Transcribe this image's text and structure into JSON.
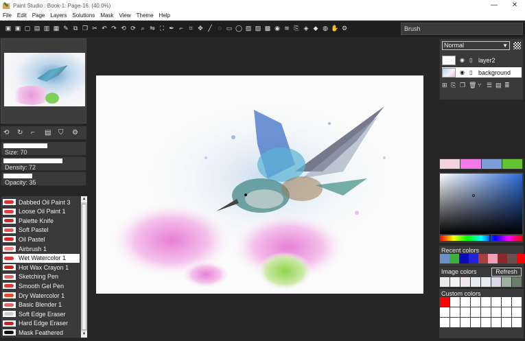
{
  "window": {
    "title": "Paint Studio : Book-1: Page-16: (40.0%)",
    "controls": [
      "—",
      "☐",
      "✕"
    ]
  },
  "menu": [
    "File",
    "Edit",
    "Page",
    "Layers",
    "Solutions",
    "Mask",
    "View",
    "Theme",
    "Help"
  ],
  "toolbar": {
    "icons": [
      "save-icon",
      "save-as-icon",
      "new-icon",
      "import-icon",
      "export-icon",
      "print-icon",
      "brush-tool-icon",
      "paste-icon",
      "copy-icon",
      "cut-icon",
      "undo-icon",
      "redo-icon",
      "rotate-left-icon",
      "rotate-right-icon",
      "zoom-icon",
      "flip-icon",
      "zoom-fit-icon",
      "pen-icon",
      "eyedropper-icon",
      "crop-icon",
      "move-icon",
      "line-icon",
      "lasso-icon",
      "rect-icon",
      "ellipse-icon",
      "fill-icon",
      "gradient-icon",
      "texture-icon",
      "eye-tool-icon",
      "smudge-icon",
      "clone-icon",
      "sharpen-icon",
      "stamp-icon",
      "blur-icon",
      "hand-icon",
      "settings-icon"
    ],
    "brush_name": "Brush"
  },
  "left": {
    "sliders": [
      {
        "label": "Size: 70",
        "value": 70,
        "max": 100
      },
      {
        "label": "Density: 72",
        "value": 72,
        "max": 100
      },
      {
        "label": "Opacity: 35",
        "value": 35,
        "max": 100
      }
    ],
    "tool_icons": [
      "rotate-icon",
      "refresh-icon",
      "pipette-icon",
      "layers-icon",
      "bucket-icon",
      "settings-icon"
    ],
    "brushes": [
      {
        "name": "Dabbed Oil Paint 3",
        "color": "#d93030"
      },
      {
        "name": "Loose Oil Paint 1",
        "color": "#e04040"
      },
      {
        "name": "Palette Knife",
        "color": "#c82a2a"
      },
      {
        "name": "Soft Pastel",
        "color": "#e85050"
      },
      {
        "name": "Oil Pastel",
        "color": "#d42424"
      },
      {
        "name": "Airbrush 1",
        "color": "#f08080"
      },
      {
        "name": "Wet Watercolor 1",
        "color": "#e03838",
        "selected": true
      },
      {
        "name": "Hot Wax Crayon 1",
        "color": "#d02020"
      },
      {
        "name": "Sketching Pen",
        "color": "#e06060"
      },
      {
        "name": "Smooth Gel Pen",
        "color": "#d83a3a"
      },
      {
        "name": "Dry Watercolor 1",
        "color": "#e04a2a"
      },
      {
        "name": "Basic Blender 1",
        "color": "#d86a6a"
      },
      {
        "name": "Soft Edge Eraser",
        "color": "#cccccc"
      },
      {
        "name": "Hard Edge Eraser",
        "color": "#cc2222"
      },
      {
        "name": "Mask Feathered",
        "color": "#111111"
      }
    ]
  },
  "layers": {
    "blend_mode": "Normal",
    "items": [
      {
        "name": "layer2",
        "selected": false
      },
      {
        "name": "background",
        "selected": true
      }
    ],
    "tool_icons": [
      "add-layer-icon",
      "import-layer-icon",
      "duplicate-layer-icon",
      "delete-layer-icon",
      "merge-icon",
      "align-icon",
      "properties-icon",
      "list-icon"
    ]
  },
  "colors": {
    "current_swatches": [
      "#f4d4dc",
      "#f27ae8",
      "#7b9ed6",
      "#62c232"
    ],
    "recent_title": "Recent colors",
    "recent": [
      "#6b8fc8",
      "#3fae3f",
      "#0b0bb8",
      "#2323d8",
      "#a84040",
      "#f0a0b8",
      "#8a2a2a",
      "#6a5050",
      "#ff0000"
    ],
    "image_title": "Image colors",
    "refresh_label": "Refresh",
    "image": [
      "#ebebeb",
      "#f2f2f4",
      "#f1e6f0",
      "#e4e9f2",
      "#e9ebf3",
      "#dcd8ec",
      "#9fb1a0",
      "#6b7e6a"
    ],
    "custom_title": "Custom colors",
    "custom": [
      "#ff0000",
      "#ffffff",
      "#ffffff",
      "#ffffff",
      "#ffffff",
      "#ffffff",
      "#ffffff",
      "#ffffff",
      "#ffffff",
      "#ffffff",
      "#ffffff",
      "#ffffff",
      "#ffffff",
      "#ffffff",
      "#ffffff",
      "#ffffff",
      "#ffffff",
      "#ffffff",
      "#ffffff",
      "#ffffff",
      "#ffffff",
      "#ffffff",
      "#ffffff",
      "#ffffff"
    ]
  }
}
